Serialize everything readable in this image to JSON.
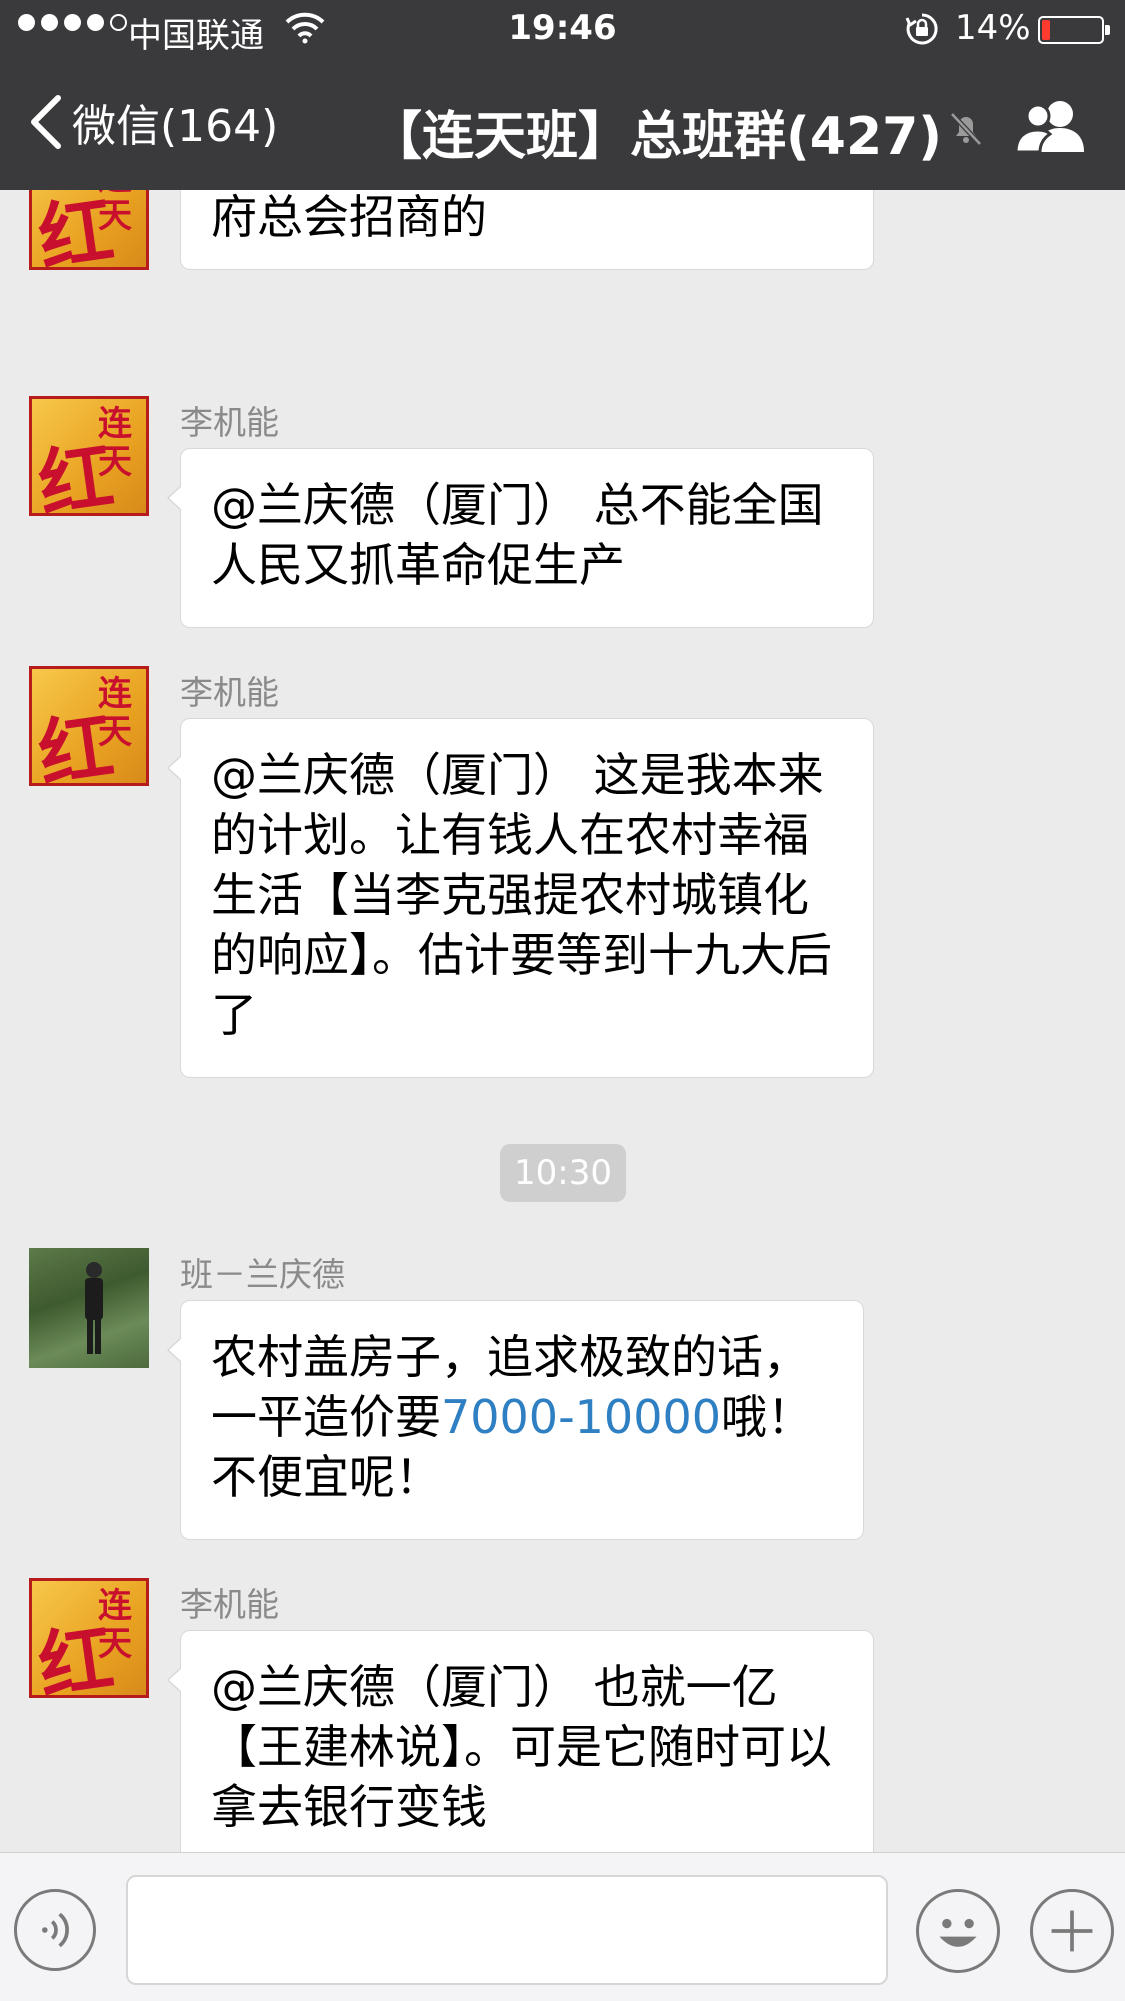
{
  "status_bar": {
    "carrier": "中国联通",
    "time": "19:46",
    "battery_percent_label": "14%",
    "battery_level": 0.14,
    "signal_bars_filled": 4,
    "signal_bars_total": 5
  },
  "nav": {
    "back_label": "微信(164)",
    "title": "【连天班】总班群(427)",
    "icons": [
      "chevron-left-icon",
      "mute-icon",
      "group-members-icon"
    ]
  },
  "messages": [
    {
      "sender": "",
      "avatar": "hong-lian-tian-logo",
      "text": "@兰庆德（厦门） 十九大后政府总会招商的"
    },
    {
      "sender": "李机能",
      "avatar": "hong-lian-tian-logo",
      "text": "@兰庆德（厦门） 总不能全国人民又抓革命促生产"
    },
    {
      "sender": "李机能",
      "avatar": "hong-lian-tian-logo",
      "text": "@兰庆德（厦门） 这是我本来的计划。让有钱人在农村幸福生活【当李克强提农村城镇化的响应】。估计要等到十九大后了"
    },
    {
      "sender": "班－兰庆德",
      "avatar": "photo",
      "text_before_link": "农村盖房子，追求极致的话，一平造价要",
      "link_text": "7000-10000",
      "text_after_link": "哦！不便宜呢！"
    },
    {
      "sender": "李机能",
      "avatar": "hong-lian-tian-logo",
      "text": "@兰庆德（厦门） 也就一亿【王建林说】。可是它随时可以拿去银行变钱"
    }
  ],
  "timestamp": "10:30",
  "avatar_logo_text": {
    "main": "红",
    "side": "连天"
  },
  "input_bar": {
    "icons": [
      "voice-icon",
      "emoji-icon",
      "plus-icon"
    ],
    "placeholder": ""
  },
  "colors": {
    "nav_background": "#3a3a3d",
    "chat_background": "#ebebeb",
    "link": "#2f7fc3",
    "battery_low": "#ff3b30",
    "sender_name": "#8a8a8a"
  }
}
